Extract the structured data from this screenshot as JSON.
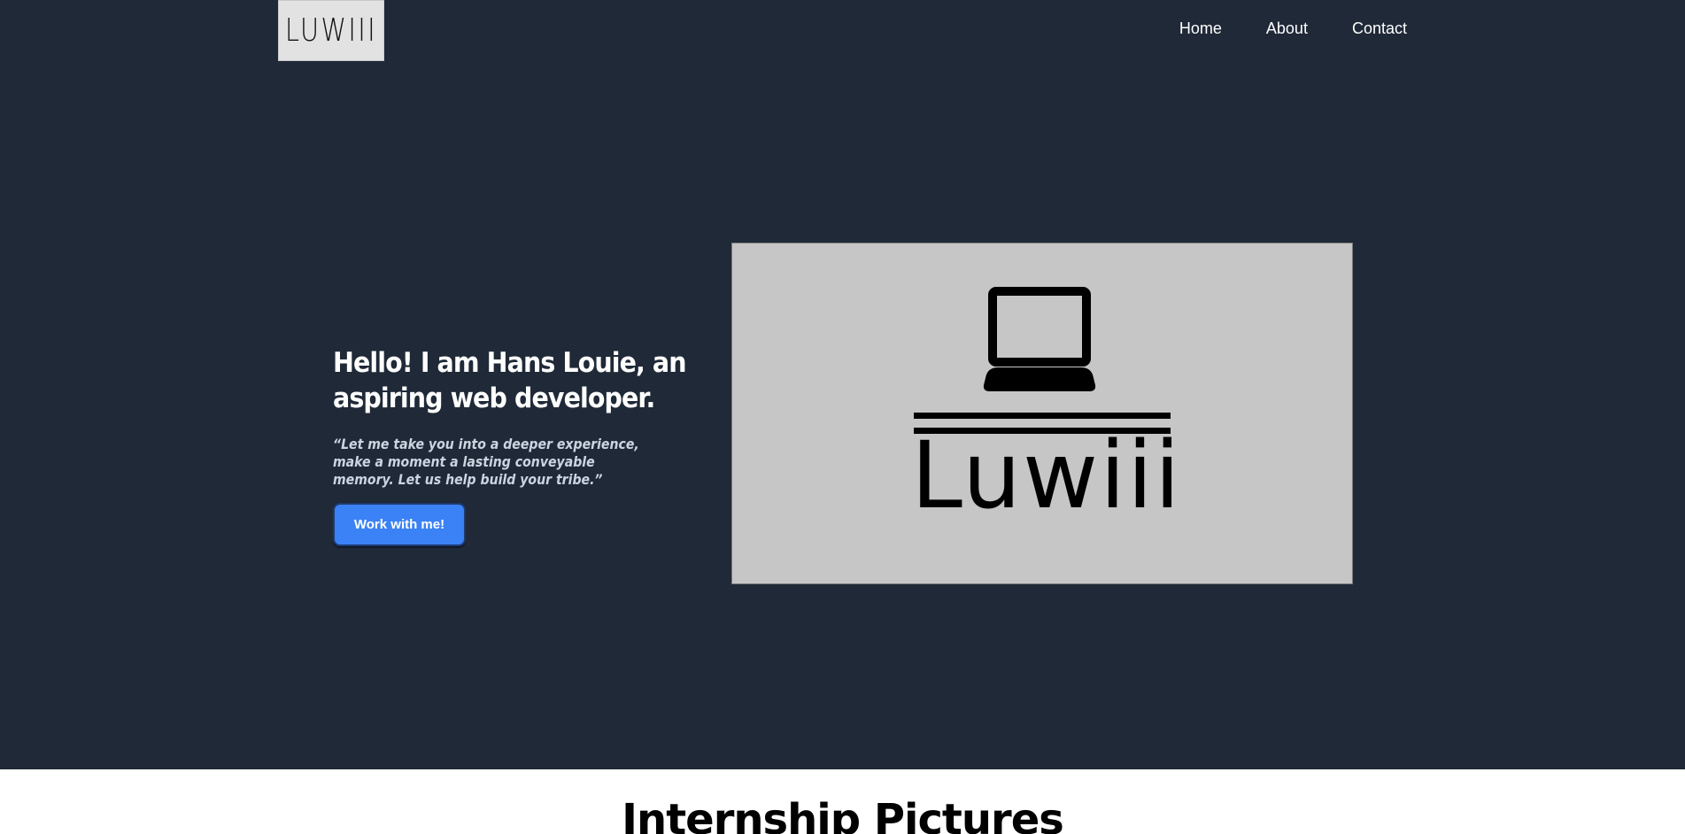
{
  "header": {
    "logo_text": "LUWIII",
    "nav": [
      {
        "label": "Home"
      },
      {
        "label": "About"
      },
      {
        "label": "Contact"
      }
    ]
  },
  "hero": {
    "title": "Hello! I am Hans Louie, an aspiring web developer.",
    "quote": "“Let me take you into a deeper experience, make a moment a lasting conveyable memory. Let us help build your tribe.”",
    "cta_label": "Work with me!",
    "image": {
      "brand_word": "Luwiii",
      "icon": "computer-icon"
    }
  },
  "internship": {
    "title": "Internship Pictures"
  },
  "colors": {
    "hero_background": "#1f2937",
    "accent": "#3b82f6",
    "image_background": "#c6c6c6"
  }
}
